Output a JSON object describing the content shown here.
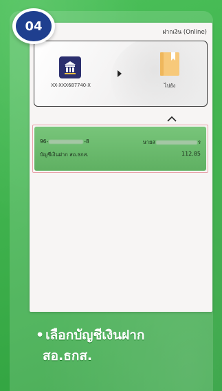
{
  "step": {
    "number": "04"
  },
  "screen": {
    "header_title": "ฝากเงิน (Online)",
    "from_account": "XX-XXX687740-X",
    "destination_label": "ไปยัง",
    "account_list": [
      {
        "account_number_prefix": "96-",
        "account_number_suffix": "-8",
        "holder_name_prefix": "นายส",
        "holder_name_suffix": "ร",
        "account_type": "บัญชีเงินฝาก สอ.ธกส.",
        "balance": "112.85"
      }
    ]
  },
  "caption": {
    "bullet": "•",
    "line1": "เลือกบัญชีเงินฝาก",
    "line2": "สอ.ธกส."
  },
  "icons": {
    "bank": "baac-logo-icon",
    "arrow": "arrow-right-icon",
    "destination": "book-icon",
    "collapse": "chevron-up-icon"
  },
  "colors": {
    "background": "#3fb24d",
    "badge": "#1f3f8f",
    "selected_account": "#6dbd70",
    "highlight_border": "#e8a0a8"
  }
}
